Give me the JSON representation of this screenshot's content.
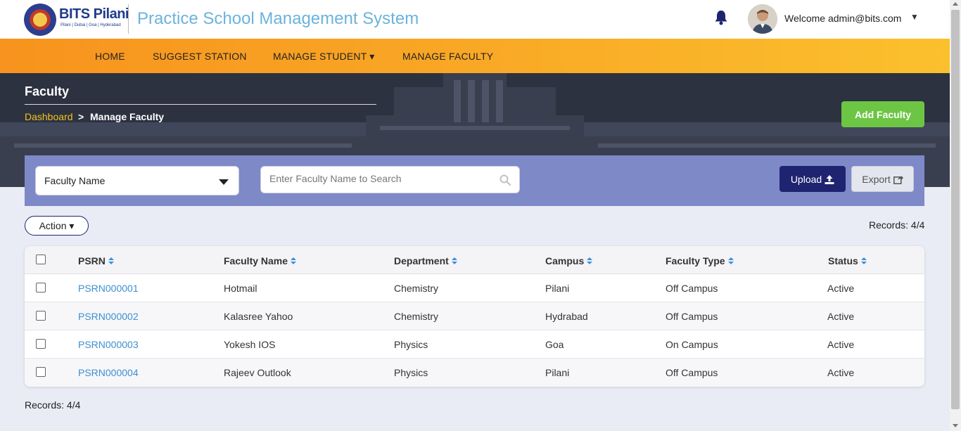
{
  "header": {
    "logo_text": "BITS Pilani",
    "logo_subtext": "Pilani | Dubai | Goa | Hyderabad",
    "app_title": "Practice School Management System",
    "welcome_text": "Welcome admin@bits.com"
  },
  "nav": {
    "items": [
      {
        "label": "HOME"
      },
      {
        "label": "SUGGEST STATION"
      },
      {
        "label": "MANAGE STUDENT ▾"
      },
      {
        "label": "MANAGE FACULTY"
      }
    ]
  },
  "banner": {
    "title": "Faculty",
    "breadcrumb_link": "Dashboard",
    "breadcrumb_separator": ">",
    "breadcrumb_current": "Manage Faculty",
    "add_button": "Add Faculty"
  },
  "filters": {
    "field_select": "Faculty Name",
    "search_placeholder": "Enter Faculty Name to Search",
    "upload_label": "Upload",
    "export_label": "Export"
  },
  "list": {
    "action_label": "Action ▾",
    "records_label": "Records: 4/4",
    "columns": [
      "PSRN",
      "Faculty Name",
      "Department",
      "Campus",
      "Faculty Type",
      "Status"
    ],
    "rows": [
      {
        "psrn": "PSRN000001",
        "name": "Hotmail",
        "department": "Chemistry",
        "campus": "Pilani",
        "type": "Off Campus",
        "status": "Active"
      },
      {
        "psrn": "PSRN000002",
        "name": "Kalasree Yahoo",
        "department": "Chemistry",
        "campus": "Hydrabad",
        "type": "Off Campus",
        "status": "Active"
      },
      {
        "psrn": "PSRN000003",
        "name": "Yokesh IOS",
        "department": "Physics",
        "campus": "Goa",
        "type": "On Campus",
        "status": "Active"
      },
      {
        "psrn": "PSRN000004",
        "name": "Rajeev Outlook",
        "department": "Physics",
        "campus": "Pilani",
        "type": "Off Campus",
        "status": "Active"
      }
    ]
  },
  "colors": {
    "nav_gradient_start": "#f7931e",
    "nav_gradient_end": "#fbc02d",
    "filter_bar": "#7e89c8",
    "add_button": "#6cc644",
    "upload_button": "#1f2470",
    "link": "#3d8fd0",
    "title": "#6bb3dd"
  },
  "icons": {
    "bell": "bell-icon",
    "avatar": "user-avatar",
    "search": "search-icon",
    "upload": "upload-icon",
    "export": "export-icon",
    "sort": "sort-icon"
  }
}
